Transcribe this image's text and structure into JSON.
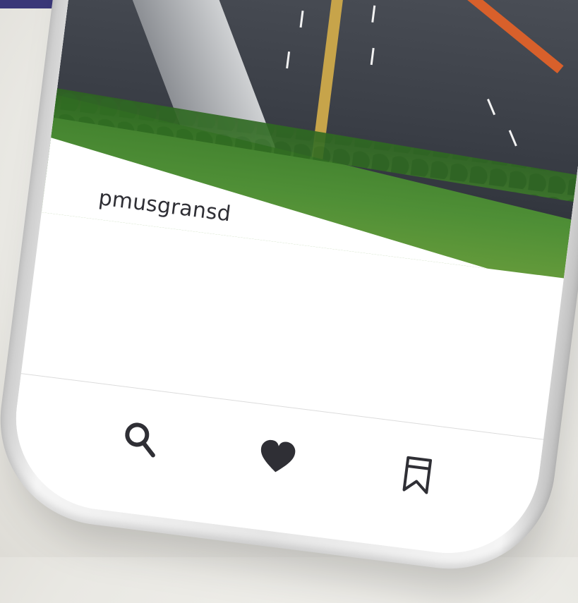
{
  "post": {
    "username": "pmusgransd"
  },
  "tab_bar": {
    "items": [
      {
        "icon": "search-icon"
      },
      {
        "icon": "heart-icon"
      },
      {
        "icon": "bookmark-icon"
      }
    ]
  },
  "colors": {
    "top_band": "#3a3778",
    "icon": "#2f2f35",
    "screen": "#ffffff",
    "frame": "#e6e6e6"
  }
}
